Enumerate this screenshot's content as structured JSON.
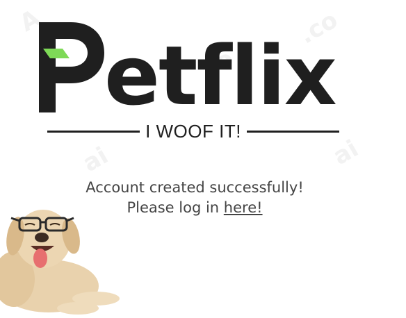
{
  "logo": {
    "text": "Petflix",
    "accent_color": "#7ed957",
    "text_color": "#1f1f1f"
  },
  "tagline": "I WOOF IT!",
  "message": {
    "line1": "Account created successfully!",
    "line2_prefix": "Please log in ",
    "link_text": "here!"
  },
  "icons": {
    "mascot": "dog-with-glasses"
  }
}
